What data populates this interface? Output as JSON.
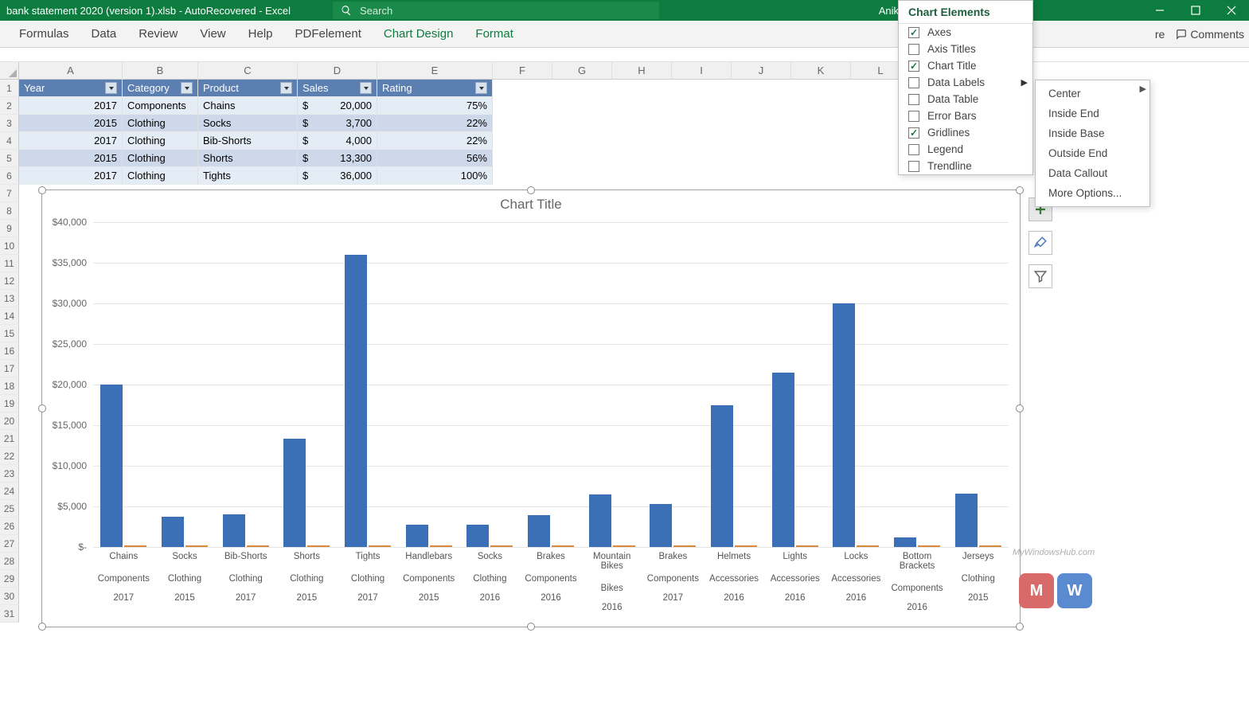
{
  "title": "bank statement 2020 (version 1).xlsb - AutoRecovered - Excel",
  "search_placeholder": "Search",
  "user": "Anik",
  "ribbon_tabs": [
    "Formulas",
    "Data",
    "Review",
    "View",
    "Help",
    "PDFelement"
  ],
  "context_tabs": [
    "Chart Design",
    "Format"
  ],
  "share_partial": "re",
  "comments_label": "Comments",
  "col_headers": [
    "A",
    "B",
    "C",
    "D",
    "E",
    "F",
    "G",
    "H",
    "I",
    "J",
    "K",
    "L"
  ],
  "row_nums": [
    1,
    2,
    3,
    4,
    5,
    6,
    7,
    8,
    9,
    10,
    11,
    12,
    13,
    14,
    15,
    16,
    17,
    18,
    19,
    20,
    21,
    22,
    23,
    24,
    25,
    26,
    27,
    28,
    29,
    30,
    31
  ],
  "table": {
    "headers": [
      "Year",
      "Category",
      "Product",
      "Sales",
      "Rating"
    ],
    "rows": [
      {
        "year": "2017",
        "category": "Components",
        "product": "Chains",
        "sales": "20,000",
        "rating": "75%"
      },
      {
        "year": "2015",
        "category": "Clothing",
        "product": "Socks",
        "sales": "3,700",
        "rating": "22%"
      },
      {
        "year": "2017",
        "category": "Clothing",
        "product": "Bib-Shorts",
        "sales": "4,000",
        "rating": "22%"
      },
      {
        "year": "2015",
        "category": "Clothing",
        "product": "Shorts",
        "sales": "13,300",
        "rating": "56%"
      },
      {
        "year": "2017",
        "category": "Clothing",
        "product": "Tights",
        "sales": "36,000",
        "rating": "100%"
      }
    ]
  },
  "chart_elements": {
    "title": "Chart Elements",
    "items": [
      {
        "label": "Axes",
        "checked": true,
        "arrow": false
      },
      {
        "label": "Axis Titles",
        "checked": false,
        "arrow": false
      },
      {
        "label": "Chart Title",
        "checked": true,
        "arrow": false
      },
      {
        "label": "Data Labels",
        "checked": false,
        "arrow": true
      },
      {
        "label": "Data Table",
        "checked": false,
        "arrow": false
      },
      {
        "label": "Error Bars",
        "checked": false,
        "arrow": false
      },
      {
        "label": "Gridlines",
        "checked": true,
        "arrow": false
      },
      {
        "label": "Legend",
        "checked": false,
        "arrow": false
      },
      {
        "label": "Trendline",
        "checked": false,
        "arrow": false
      }
    ]
  },
  "submenu": [
    "Center",
    "Inside End",
    "Inside Base",
    "Outside End",
    "Data Callout",
    "More Options..."
  ],
  "chart_data": {
    "type": "bar",
    "title": "Chart Title",
    "ylabel_format": "currency",
    "ylim": [
      0,
      40000
    ],
    "yticks": [
      "$-",
      "$5,000",
      "$10,000",
      "$15,000",
      "$20,000",
      "$25,000",
      "$30,000",
      "$35,000",
      "$40,000"
    ],
    "categories": [
      {
        "product": "Chains",
        "category": "Components",
        "year": "2017"
      },
      {
        "product": "Socks",
        "category": "Clothing",
        "year": "2015"
      },
      {
        "product": "Bib-Shorts",
        "category": "Clothing",
        "year": "2017"
      },
      {
        "product": "Shorts",
        "category": "Clothing",
        "year": "2015"
      },
      {
        "product": "Tights",
        "category": "Clothing",
        "year": "2017"
      },
      {
        "product": "Handlebars",
        "category": "Components",
        "year": "2015"
      },
      {
        "product": "Socks",
        "category": "Clothing",
        "year": "2016"
      },
      {
        "product": "Brakes",
        "category": "Components",
        "year": "2016"
      },
      {
        "product": "Mountain Bikes",
        "category": "Bikes",
        "year": "2016"
      },
      {
        "product": "Brakes",
        "category": "Components",
        "year": "2017"
      },
      {
        "product": "Helmets",
        "category": "Accessories",
        "year": "2016"
      },
      {
        "product": "Lights",
        "category": "Accessories",
        "year": "2016"
      },
      {
        "product": "Locks",
        "category": "Accessories",
        "year": "2016"
      },
      {
        "product": "Bottom Brackets",
        "category": "Components",
        "year": "2016"
      },
      {
        "product": "Jerseys",
        "category": "Clothing",
        "year": "2015"
      }
    ],
    "series": [
      {
        "name": "Sales",
        "color": "#3b6fb6",
        "values": [
          20000,
          3700,
          4000,
          13300,
          36000,
          2700,
          2700,
          3900,
          6500,
          5300,
          17500,
          21500,
          30000,
          1200,
          6600
        ]
      },
      {
        "name": "Rating",
        "color": "#d98a3a",
        "values": [
          0.75,
          0.22,
          0.22,
          0.56,
          1.0,
          0.08,
          0.08,
          0.11,
          0.18,
          0.15,
          0.49,
          0.6,
          0.83,
          0.03,
          0.18
        ]
      }
    ]
  },
  "watermark": "MyWindowsHub.com"
}
